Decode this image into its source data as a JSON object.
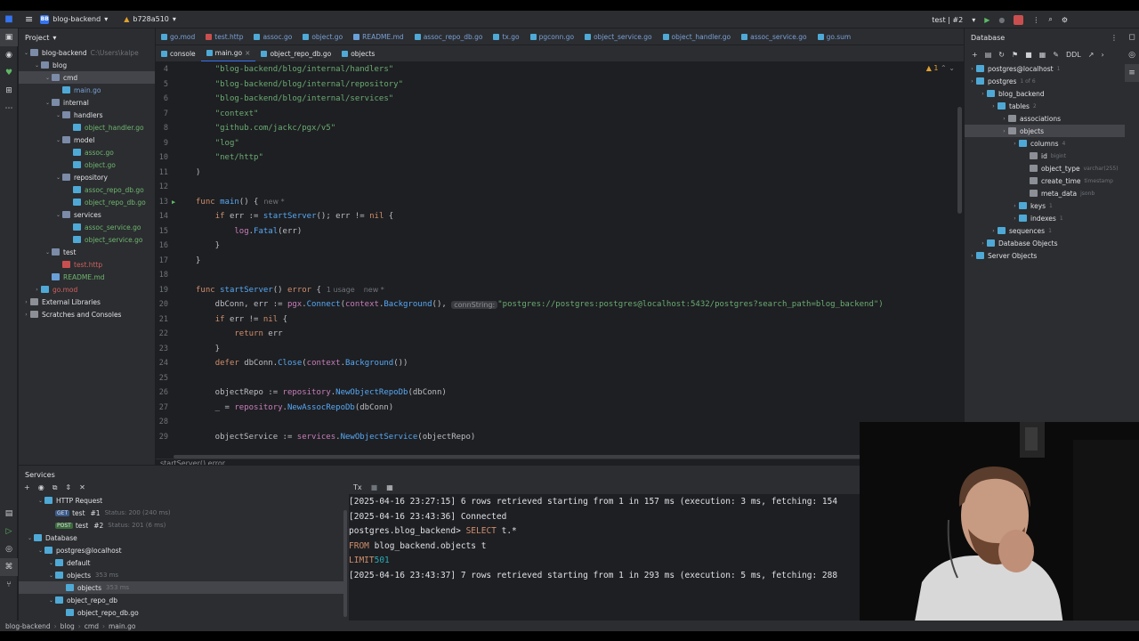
{
  "titlebar": {
    "project": "blog-backend",
    "project_badge": "BB",
    "branch": "b728a510",
    "run_config": "test | #2"
  },
  "project_panel": {
    "title": "Project",
    "tree": [
      {
        "label": "blog-backend",
        "extra": "C:\\Users\\kalpe",
        "depth": 0,
        "type": "folder",
        "open": true
      },
      {
        "label": "blog",
        "depth": 1,
        "type": "folder",
        "open": true
      },
      {
        "label": "cmd",
        "depth": 2,
        "type": "folder",
        "open": true,
        "selected": true
      },
      {
        "label": "main.go",
        "depth": 3,
        "type": "go"
      },
      {
        "label": "internal",
        "depth": 2,
        "type": "folder",
        "open": true
      },
      {
        "label": "handlers",
        "depth": 3,
        "type": "folder",
        "open": true
      },
      {
        "label": "object_handler.go",
        "depth": 4,
        "type": "go",
        "green": true
      },
      {
        "label": "model",
        "depth": 3,
        "type": "folder",
        "open": true
      },
      {
        "label": "assoc.go",
        "depth": 4,
        "type": "go",
        "green": true
      },
      {
        "label": "object.go",
        "depth": 4,
        "type": "go",
        "green": true
      },
      {
        "label": "repository",
        "depth": 3,
        "type": "folder",
        "open": true
      },
      {
        "label": "assoc_repo_db.go",
        "depth": 4,
        "type": "go",
        "green": true
      },
      {
        "label": "object_repo_db.go",
        "depth": 4,
        "type": "go",
        "green": true
      },
      {
        "label": "services",
        "depth": 3,
        "type": "folder",
        "open": true
      },
      {
        "label": "assoc_service.go",
        "depth": 4,
        "type": "go",
        "green": true
      },
      {
        "label": "object_service.go",
        "depth": 4,
        "type": "go",
        "green": true
      },
      {
        "label": "test",
        "depth": 2,
        "type": "folder",
        "open": true
      },
      {
        "label": "test.http",
        "depth": 3,
        "type": "http",
        "red": true
      },
      {
        "label": "README.md",
        "depth": 2,
        "type": "md",
        "green": true
      },
      {
        "label": "go.mod",
        "depth": 1,
        "type": "mod",
        "red": true,
        "collapsed": true
      },
      {
        "label": "External Libraries",
        "depth": 0,
        "type": "lib",
        "collapsed": true
      },
      {
        "label": "Scratches and Consoles",
        "depth": 0,
        "type": "lib",
        "collapsed": true
      }
    ]
  },
  "editor": {
    "tabs_row1": [
      "go.mod",
      "test.http",
      "assoc.go",
      "object.go",
      "README.md",
      "assoc_repo_db.go",
      "tx.go",
      "pgconn.go",
      "object_service.go",
      "object_handler.go",
      "assoc_service.go",
      "go.sum"
    ],
    "tabs_row2": [
      "console",
      "main.go",
      "object_repo_db.go",
      "objects"
    ],
    "active_tab": "main.go",
    "warning_count": "1",
    "breadcrumb": "startServer() error",
    "lines": [
      {
        "n": "4",
        "text": "    \"blog-backend/blog/internal/handlers\""
      },
      {
        "n": "5",
        "text": "    \"blog-backend/blog/internal/repository\""
      },
      {
        "n": "6",
        "text": "    \"blog-backend/blog/internal/services\""
      },
      {
        "n": "7",
        "text": "    \"context\""
      },
      {
        "n": "8",
        "text": "    \"github.com/jackc/pgx/v5\""
      },
      {
        "n": "9",
        "text": "    \"log\""
      },
      {
        "n": "10",
        "text": "    \"net/http\""
      },
      {
        "n": "11",
        "text": ")"
      },
      {
        "n": "12",
        "text": ""
      },
      {
        "n": "13",
        "text": "func main() {"
      },
      {
        "n": "14",
        "text": "    if err := startServer(); err != nil {"
      },
      {
        "n": "15",
        "text": "        log.Fatal(err)"
      },
      {
        "n": "16",
        "text": "    }"
      },
      {
        "n": "17",
        "text": "}"
      },
      {
        "n": "18",
        "text": ""
      },
      {
        "n": "19",
        "text": "func startServer() error {"
      },
      {
        "n": "20",
        "text": "    dbConn, err := pgx.Connect(context.Background(), "
      },
      {
        "n": "21",
        "text": "    if err != nil {"
      },
      {
        "n": "22",
        "text": "        return err"
      },
      {
        "n": "23",
        "text": "    }"
      },
      {
        "n": "24",
        "text": "    defer dbConn.Close(context.Background())"
      },
      {
        "n": "25",
        "text": ""
      },
      {
        "n": "26",
        "text": "    objectRepo := repository.NewObjectRepoDb(dbConn)"
      },
      {
        "n": "27",
        "text": "    _ = repository.NewAssocRepoDb(dbConn)"
      },
      {
        "n": "28",
        "text": ""
      },
      {
        "n": "29",
        "text": "    objectService := services.NewObjectService(objectRepo)"
      }
    ],
    "hint_new": "new *",
    "hint_usage": "1 usage",
    "inlay_connstring": "connString:",
    "conn_value": "\"postgres://postgres:postgres@localhost:5432/postgres?search_path=blog_backend\")"
  },
  "database_panel": {
    "title": "Database",
    "toolbar_ddl": "DDL",
    "tree": [
      {
        "label": "postgres@localhost",
        "meta": "1",
        "depth": 0
      },
      {
        "label": "postgres",
        "meta": "1 of 6",
        "depth": 0
      },
      {
        "label": "blog_backend",
        "meta": "",
        "depth": 1
      },
      {
        "label": "tables",
        "meta": "2",
        "depth": 2
      },
      {
        "label": "associations",
        "meta": "",
        "depth": 3
      },
      {
        "label": "objects",
        "meta": "",
        "depth": 3,
        "selected": true
      },
      {
        "label": "columns",
        "meta": "4",
        "depth": 4
      },
      {
        "label": "id",
        "meta": "bigint",
        "depth": 5
      },
      {
        "label": "object_type",
        "meta": "varchar(255)",
        "depth": 5
      },
      {
        "label": "create_time",
        "meta": "timestamp",
        "depth": 5
      },
      {
        "label": "meta_data",
        "meta": "jsonb",
        "depth": 5
      },
      {
        "label": "keys",
        "meta": "1",
        "depth": 4
      },
      {
        "label": "indexes",
        "meta": "1",
        "depth": 4
      },
      {
        "label": "sequences",
        "meta": "1",
        "depth": 2
      },
      {
        "label": "Database Objects",
        "meta": "",
        "depth": 1
      },
      {
        "label": "Server Objects",
        "meta": "",
        "depth": 0
      }
    ]
  },
  "services": {
    "title": "Services",
    "tree": [
      {
        "label": "HTTP Request",
        "depth": 1
      },
      {
        "method": "GET",
        "label": "test",
        "run": "#1",
        "status": "Status: 200 (240 ms)",
        "depth": 2
      },
      {
        "method": "POST",
        "label": "test",
        "run": "#2",
        "status": "Status: 201 (6 ms)",
        "depth": 2
      },
      {
        "label": "Database",
        "depth": 0
      },
      {
        "label": "postgres@localhost",
        "depth": 1
      },
      {
        "label": "default",
        "depth": 2
      },
      {
        "label": "objects",
        "status": "353 ms",
        "depth": 2
      },
      {
        "label": "objects",
        "status": "353 ms",
        "depth": 3,
        "selected": true
      },
      {
        "label": "object_repo_db",
        "depth": 2
      },
      {
        "label": "object_repo_db.go",
        "depth": 3
      }
    ],
    "console": [
      "[2025-04-16 23:27:15] 6 rows retrieved starting from 1 in 157 ms (execution: 3 ms, fetching: 154",
      "[2025-04-16 23:43:36] Connected",
      "postgres.blog_backend> SELECT t.*",
      "                       FROM blog_backend.objects t",
      "                       LIMIT 501",
      "[2025-04-16 23:43:37] 7 rows retrieved starting from 1 in 293 ms (execution: 5 ms, fetching: 288"
    ]
  },
  "statusbar": [
    "blog-backend",
    "blog",
    "cmd",
    "main.go"
  ]
}
